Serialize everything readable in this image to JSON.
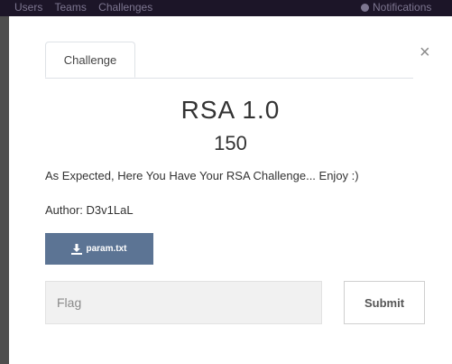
{
  "background": {
    "nav_links": [
      "Users",
      "Teams",
      "Challenges"
    ],
    "notifications_label": "Notifications"
  },
  "modal": {
    "close_label": "×",
    "tabs": [
      {
        "label": "Challenge"
      }
    ],
    "challenge": {
      "name": "RSA 1.0",
      "value": "150",
      "description": "As Expected, Here You Have Your RSA Challenge... Enjoy :)",
      "author": "Author: D3v1LaL",
      "file_label": "param.txt"
    },
    "flag_input": {
      "placeholder": "Flag",
      "value": ""
    },
    "submit_label": "Submit"
  },
  "colors": {
    "navbar_bg": "#1c1528",
    "file_button_bg": "#5c7494",
    "input_bg": "#f1f1f1"
  },
  "icons": {
    "file": "download-icon",
    "close": "close-icon"
  }
}
